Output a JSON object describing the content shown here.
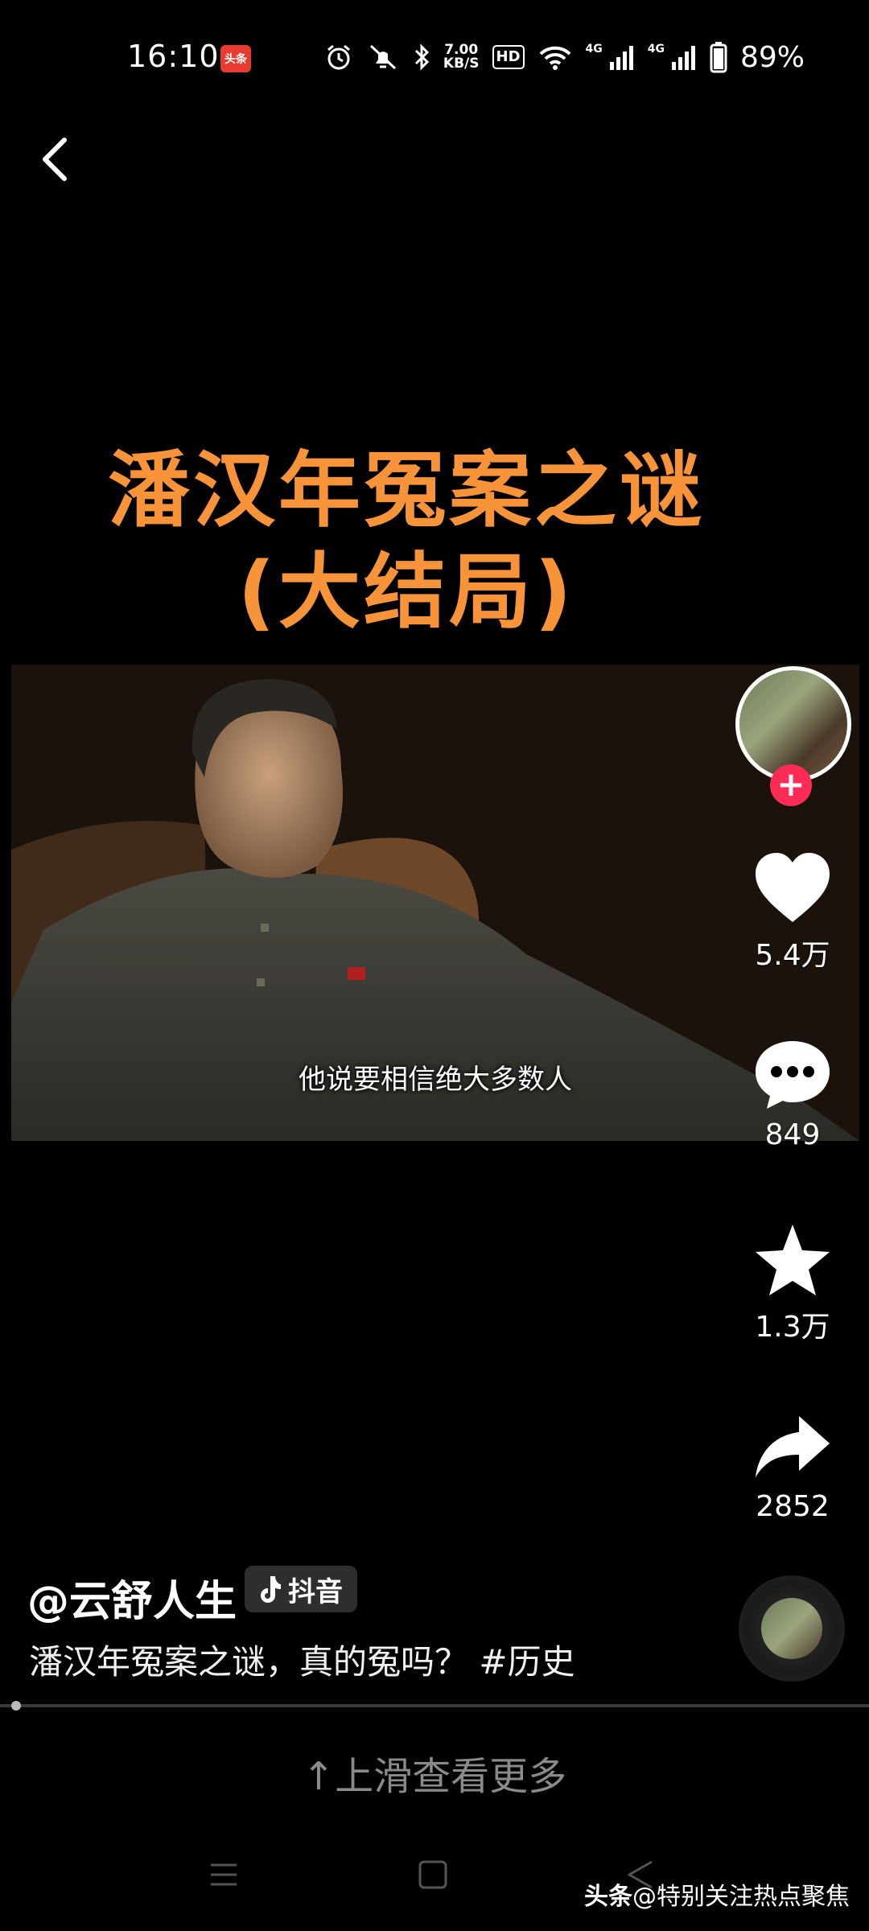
{
  "status_bar": {
    "time": "16:10",
    "app_badge": "头条",
    "net_speed_value": "7.00",
    "net_speed_unit": "KB/S",
    "hd_label": "HD",
    "net_1": "4G",
    "net_2": "4G",
    "battery_percent": "89%",
    "icons": [
      "alarm-icon",
      "mute-icon",
      "bluetooth-icon",
      "wifi-icon",
      "signal-icon",
      "battery-icon"
    ]
  },
  "video": {
    "title_line1": "潘汉年冤案之谜",
    "title_line2": "(大结局)",
    "subtitle": "他说要相信绝大多数人",
    "accent_color": "#f7943a"
  },
  "actions": {
    "likes": "5.4万",
    "comments": "849",
    "favorites": "1.3万",
    "shares": "2852",
    "follow_symbol": "+"
  },
  "post": {
    "author": "@云舒人生",
    "source_tag": "抖音",
    "caption_text": "潘汉年冤案之谜，真的冤吗？",
    "hashtag": "#历史"
  },
  "swipe_hint": "↑上滑查看更多",
  "watermark": {
    "brand": "头条",
    "account": "@特别关注热点聚焦"
  }
}
